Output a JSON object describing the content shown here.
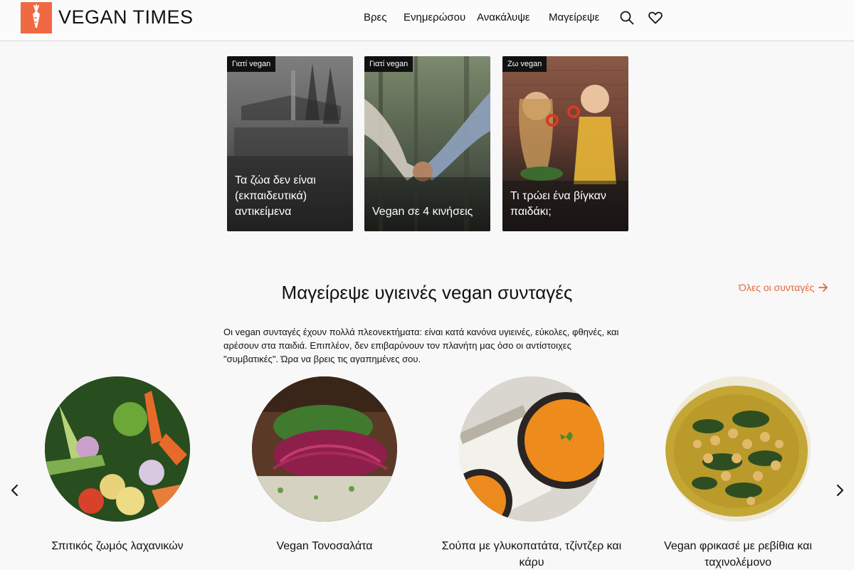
{
  "brand": {
    "name": "VEGAN TIMES",
    "accent": "#ef6a42"
  },
  "nav": {
    "items": [
      "Βρες",
      "Ενημερώσου",
      "Ανακάλυψε",
      "Μαγείρεψε"
    ],
    "icons": [
      "search-icon",
      "heart-icon"
    ]
  },
  "featured": [
    {
      "tag": "Γιατί vegan",
      "title": "Τα ζώα δεν είναι (εκπαιδευτικά) αντικείμενα"
    },
    {
      "tag": "Γιατί vegan",
      "title": "Vegan σε 4 κινήσεις"
    },
    {
      "tag": "Ζω vegan",
      "title": "Τι τρώει ένα βίγκαν παιδάκι;"
    }
  ],
  "recipes_section": {
    "title": "Μαγείρεψε υγιεινές vegan συνταγές",
    "all_link": "Όλες οι συνταγές",
    "intro": "Οι vegan συνταγές έχουν πολλά πλεονεκτήματα: είναι κατά κανόνα υγιεινές, εύκολες, φθηνές, και αρέσουν στα παιδιά. Επιπλέον, δεν επιβαρύνουν τον πλανήτη μας όσο οι αντίστοιχες \"συμβατικές\". Ώρα να βρεις τις αγαπημένες σου.",
    "recipes": [
      {
        "name": "Σπιτικός ζωμός λαχανικών"
      },
      {
        "name": "Vegan Τονοσαλάτα"
      },
      {
        "name": "Σούπα με γλυκοπατάτα, τζίντζερ και κάρυ"
      },
      {
        "name": "Vegan φρικασέ με ρεβίθια και ταχινολέμονο"
      }
    ]
  }
}
